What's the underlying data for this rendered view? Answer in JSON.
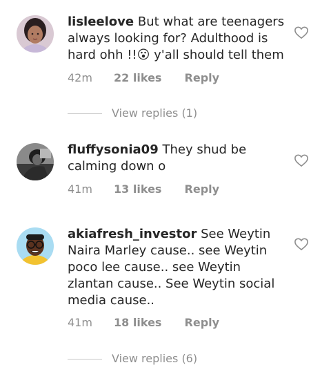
{
  "comments": [
    {
      "username": "lisleelove",
      "text": "But what are teenagers always looking for? Adulthood is hard ohh !!😮 y'all should tell them",
      "time": "42m",
      "likes": "22 likes",
      "reply_label": "Reply",
      "view_replies": "View replies (1)"
    },
    {
      "username": "fluffysonia09",
      "text": "They shud be calming down o",
      "time": "41m",
      "likes": "13 likes",
      "reply_label": "Reply"
    },
    {
      "username": "akiafresh_investor",
      "text": "See Weytin Naira Marley cause.. see Weytin poco lee cause.. see Weytin zlantan cause.. See Weytin social media cause..",
      "time": "41m",
      "likes": "18 likes",
      "reply_label": "Reply",
      "view_replies": "View replies (6)"
    }
  ],
  "icons": {
    "like": "heart-outline-icon"
  }
}
